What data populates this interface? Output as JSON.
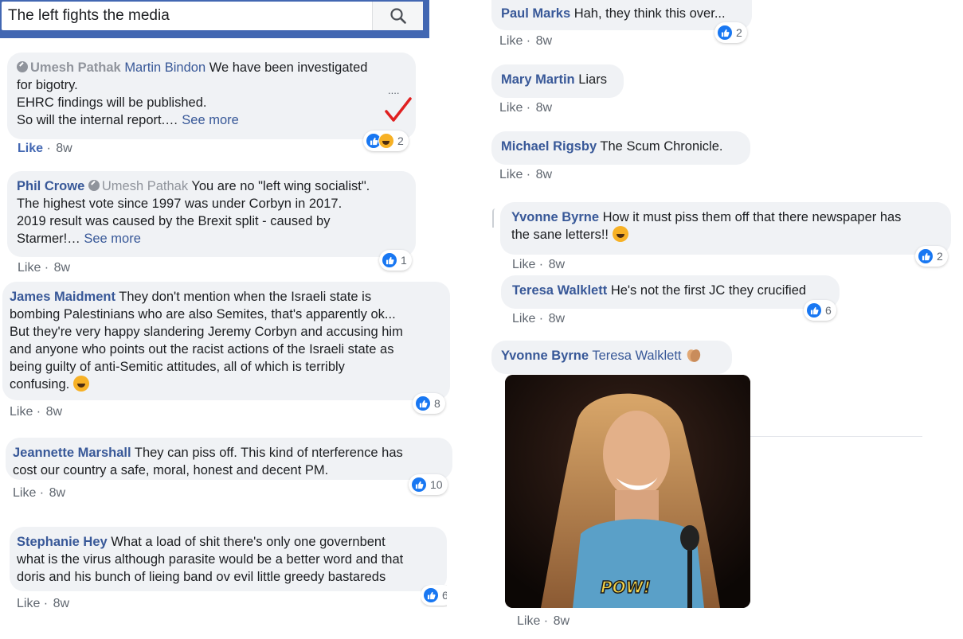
{
  "search": {
    "value": "The left fights the media",
    "icon": "search-icon"
  },
  "left_comments": [
    {
      "author": "Umesh Pathak",
      "mention": "Martin Bindon",
      "lines": [
        "We have been investigated",
        "for bigotry.",
        "EHRC findings will be published.",
        "So will the internal report.…"
      ],
      "see_more": "See more",
      "like": "Like",
      "time": "8w",
      "reactions": "2",
      "annotation_dots": "....",
      "annotation_mark": "check-mark-icon"
    },
    {
      "author": "Phil Crowe",
      "mention": "Umesh Pathak",
      "lines": [
        "You are no \"left wing socialist\".",
        "The highest vote since 1997 was under Corbyn in 2017.",
        "2019 result was caused by the Brexit split - caused by",
        "Starmer!…"
      ],
      "see_more": "See more",
      "like": "Like",
      "time": "8w",
      "reactions": "1"
    },
    {
      "author": "James Maidment",
      "lines": [
        "They don't mention when the Israeli state is",
        "bombing Palestinians who are also Semites, that's apparently ok...",
        "But they're very happy slandering Jeremy Corbyn and accusing him",
        "and anyone who points out the racist actions of the Israeli state as",
        "being guilty of anti-Semitic attitudes, all of which is terribly",
        "confusing."
      ],
      "like": "Like",
      "time": "8w",
      "reactions": "8"
    },
    {
      "author": "Jeannette Marshall",
      "lines": [
        "They can piss off. This kind of nterference has",
        "cost our country a safe, moral, honest and decent PM."
      ],
      "like": "Like",
      "time": "8w",
      "reactions": "10"
    },
    {
      "author": "Stephanie Hey",
      "lines": [
        "What a load of shit there's only one governbent",
        "what is the virus although parasite would be a better word and that",
        "doris and his bunch of lieing band ov evil little greedy bastareds"
      ],
      "like": "Like",
      "time": "8w",
      "reactions": "6"
    }
  ],
  "right_comments": [
    {
      "author": "Paul Marks",
      "lines": [
        "Hah, they think this over..."
      ],
      "like": "Like",
      "time": "8w",
      "reactions": "2"
    },
    {
      "author": "Mary Martin",
      "lines": [
        "Liars"
      ],
      "like": "Like",
      "time": "8w"
    },
    {
      "author": "Michael Rigsby",
      "lines": [
        "The Scum Chronicle."
      ],
      "like": "Like",
      "time": "8w"
    },
    {
      "author": "Yvonne Byrne",
      "lines": [
        "How it must piss them off that there newspaper has",
        "the sane letters!!"
      ],
      "like": "Like",
      "time": "8w",
      "reactions": "2"
    },
    {
      "author": "Teresa Walklett",
      "lines": [
        "He's not the first JC they crucified"
      ],
      "like": "Like",
      "time": "8w",
      "reactions": "6"
    },
    {
      "author": "Yvonne Byrne",
      "mention": "Teresa Walklett",
      "like": "Like",
      "time": "8w",
      "gif_caption": "POW!"
    }
  ],
  "colors": {
    "link": "#385898",
    "bubble": "#f0f2f5",
    "header": "#4267b2",
    "like_blue": "#1877f2",
    "check": "#e02020"
  }
}
